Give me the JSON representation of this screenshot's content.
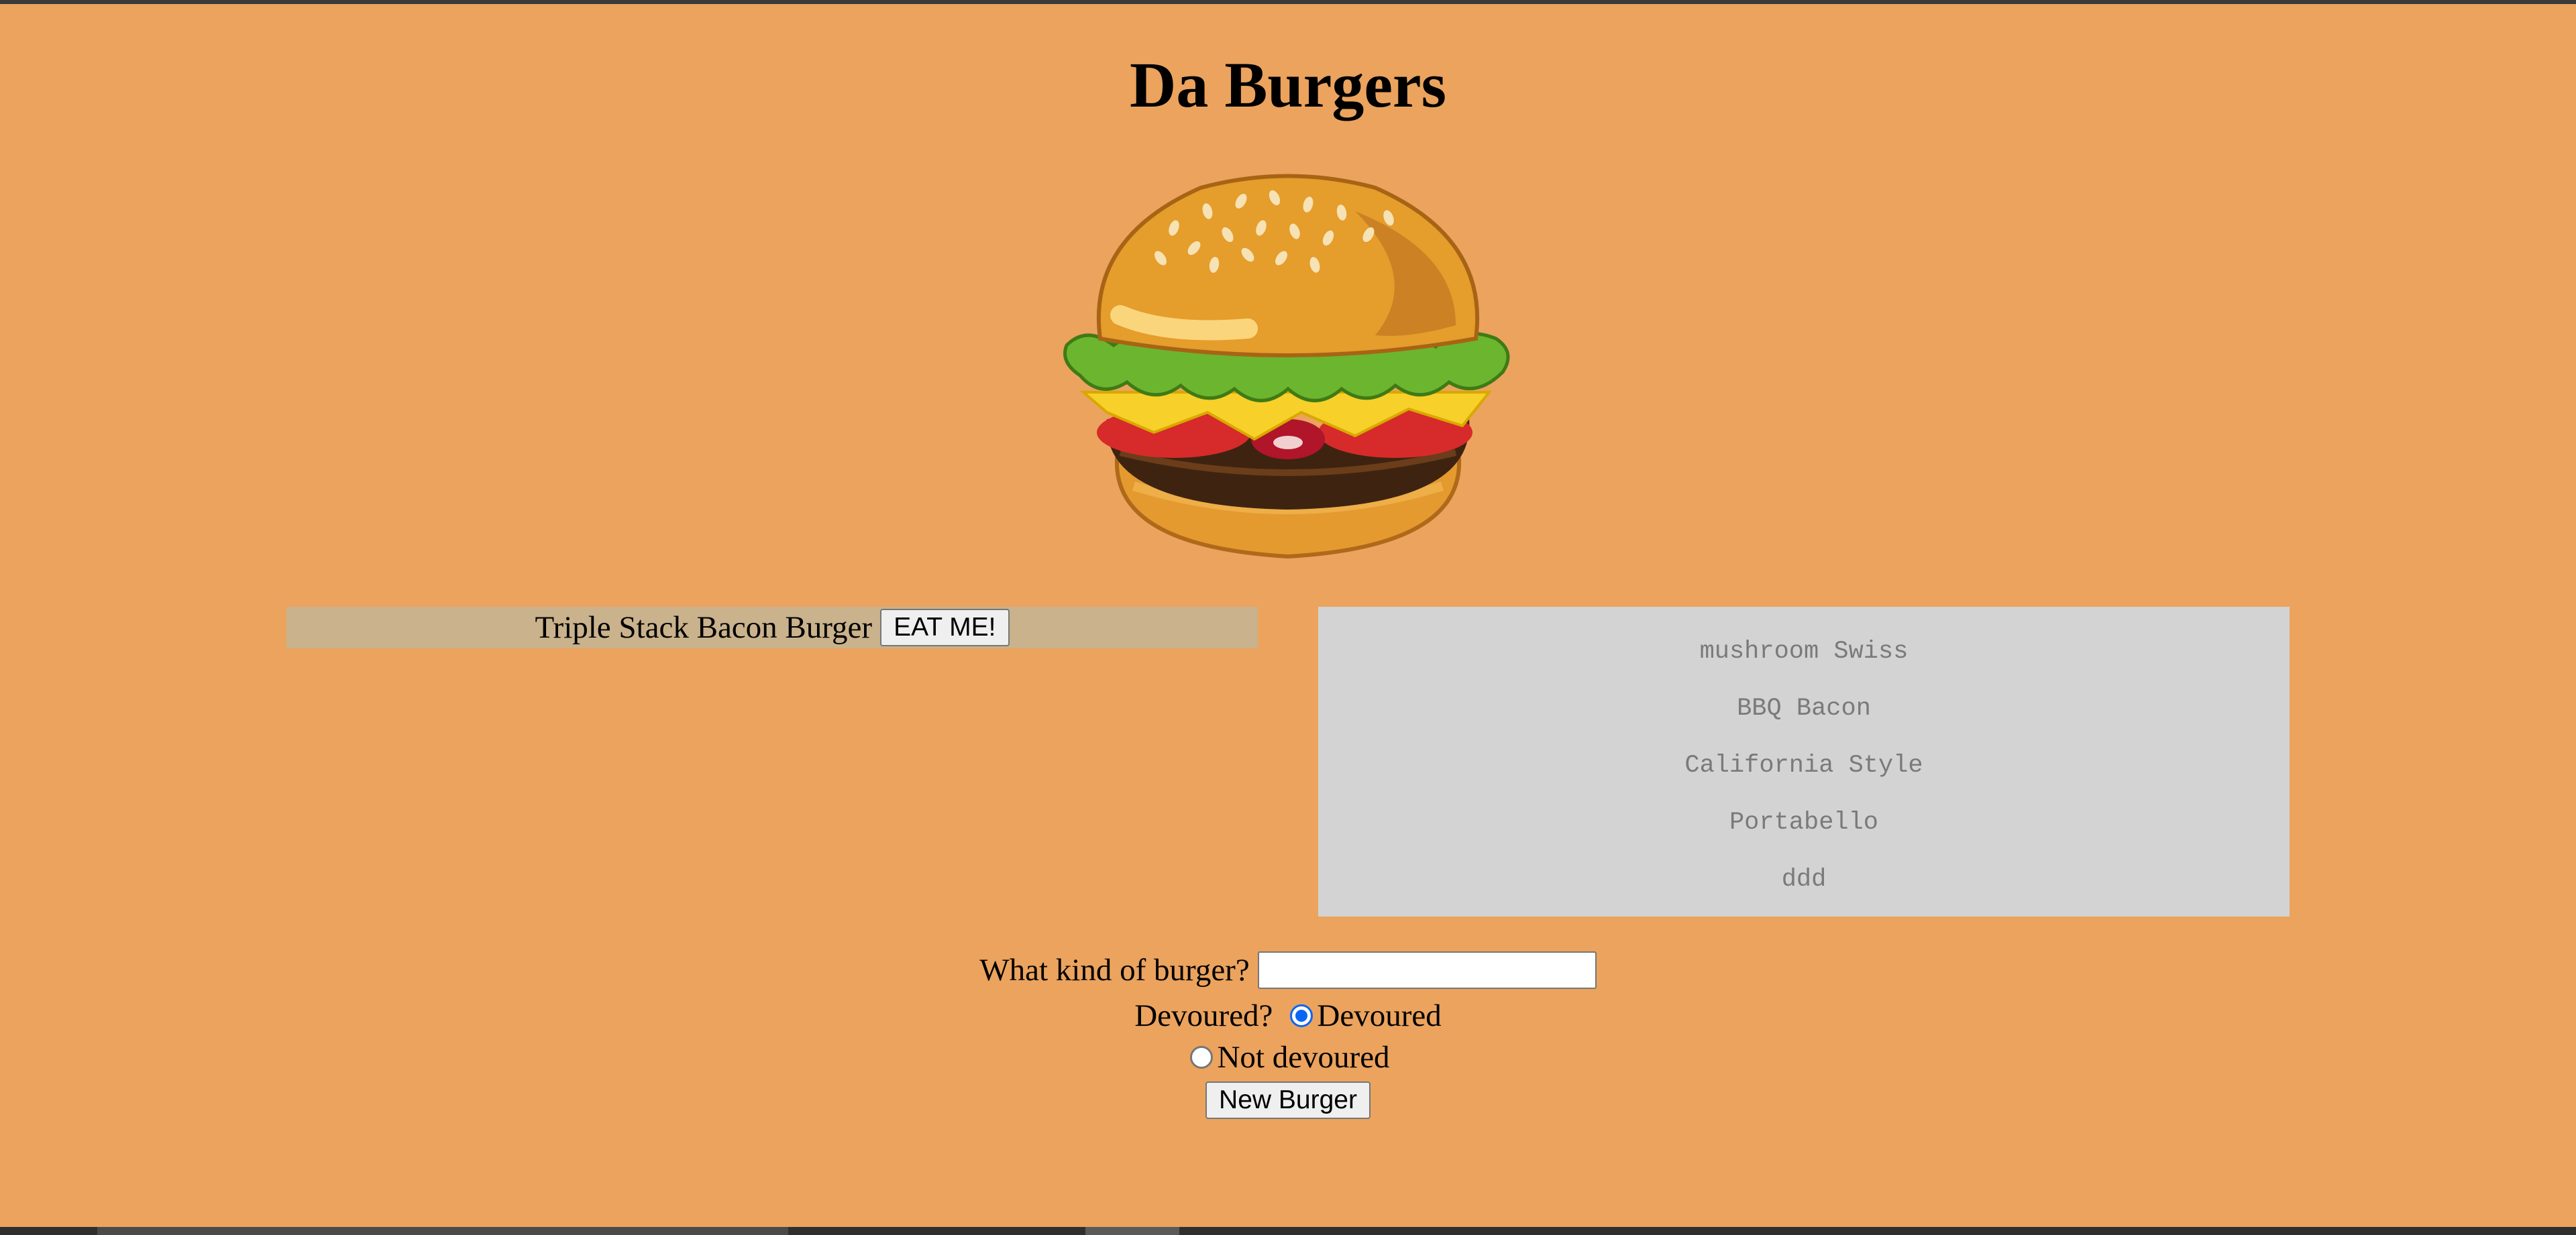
{
  "page": {
    "title": "Da Burgers"
  },
  "burger_image": {
    "icon": "burger-illustration"
  },
  "undevoured": {
    "items": [
      {
        "name": "Triple Stack Bacon Burger",
        "button_label": "EAT ME!"
      }
    ]
  },
  "devoured": {
    "items": [
      "mushroom Swiss",
      "BBQ Bacon",
      "California Style",
      "Portabello",
      "ddd"
    ]
  },
  "form": {
    "burger_label": "What kind of burger?",
    "burger_value": "",
    "devoured_label": "Devoured?",
    "option_devoured": "Devoured",
    "option_not_devoured": "Not devoured",
    "selected_option": "Devoured",
    "submit_label": "New Burger"
  },
  "colors": {
    "background": "#eba35e",
    "undevoured_panel": "#c9b28c",
    "devoured_panel": "#d3d3d3",
    "radio_accent": "#0b66f5"
  }
}
